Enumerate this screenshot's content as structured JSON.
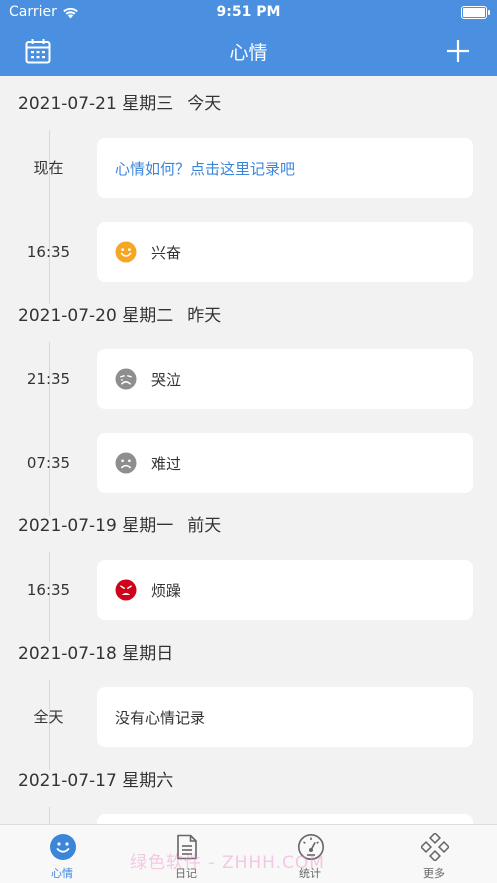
{
  "status_bar": {
    "carrier": "Carrier",
    "time": "9:51 PM"
  },
  "nav": {
    "title": "心情",
    "left_icon": "calendar-icon",
    "right_icon": "plus-icon"
  },
  "colors": {
    "accent": "#4a8fe0",
    "link": "#3b86d9",
    "happy": "#f5a623",
    "angry": "#d0021b",
    "neutral": "#8e8e8e"
  },
  "days": [
    {
      "date": "2021-07-21 星期三",
      "relative": "今天",
      "entries": [
        {
          "time": "现在",
          "text": "心情如何？点击这里记录吧",
          "icon": ""
        },
        {
          "time": "16:35",
          "text": "兴奋",
          "icon": "excited-face-icon"
        }
      ]
    },
    {
      "date": "2021-07-20 星期二",
      "relative": "昨天",
      "entries": [
        {
          "time": "21:35",
          "text": "哭泣",
          "icon": "crying-face-icon"
        },
        {
          "time": "07:35",
          "text": "难过",
          "icon": "sad-face-icon"
        }
      ]
    },
    {
      "date": "2021-07-19 星期一",
      "relative": "前天",
      "entries": [
        {
          "time": "16:35",
          "text": "烦躁",
          "icon": "irritated-face-icon"
        }
      ]
    },
    {
      "date": "2021-07-18 星期日",
      "relative": "",
      "entries": [
        {
          "time": "全天",
          "text": "没有心情记录",
          "icon": ""
        }
      ]
    },
    {
      "date": "2021-07-17 星期六",
      "relative": "",
      "entries": []
    }
  ],
  "tabs": [
    {
      "label": "心情",
      "icon": "mood-face-icon",
      "active": true
    },
    {
      "label": "日记",
      "icon": "diary-document-icon",
      "active": false
    },
    {
      "label": "统计",
      "icon": "gauge-icon",
      "active": false
    },
    {
      "label": "更多",
      "icon": "more-grid-icon",
      "active": false
    }
  ],
  "watermark": "绿色软件 - ZHHH.COM"
}
